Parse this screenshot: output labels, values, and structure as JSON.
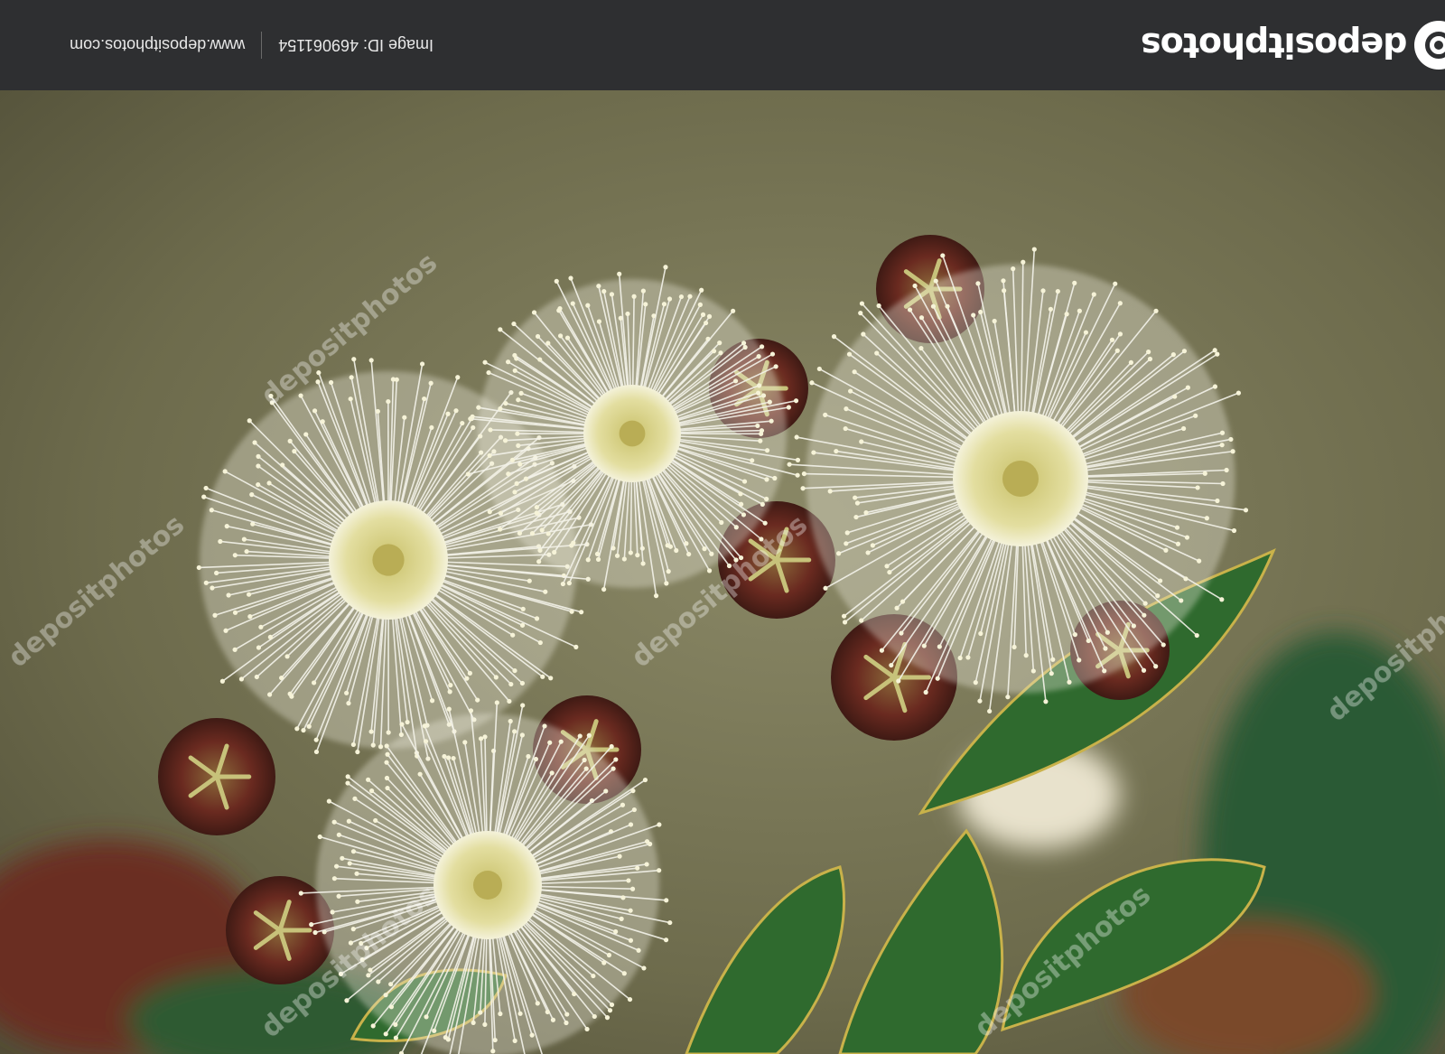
{
  "header": {
    "brand": "depositphotos",
    "image_id": "Image ID: 469061154",
    "site_url": "www.depositphotos.com"
  },
  "photo": {
    "subject": "",
    "watermark_text": "depositphotos"
  },
  "colors": {
    "bar_bg": "#2e2f31",
    "petal": "#f4f3ea",
    "center": "#d9d48a",
    "leaf": "#2f6a2e",
    "bud": "#6b2b22",
    "background_blur": "#6f6c4c"
  }
}
